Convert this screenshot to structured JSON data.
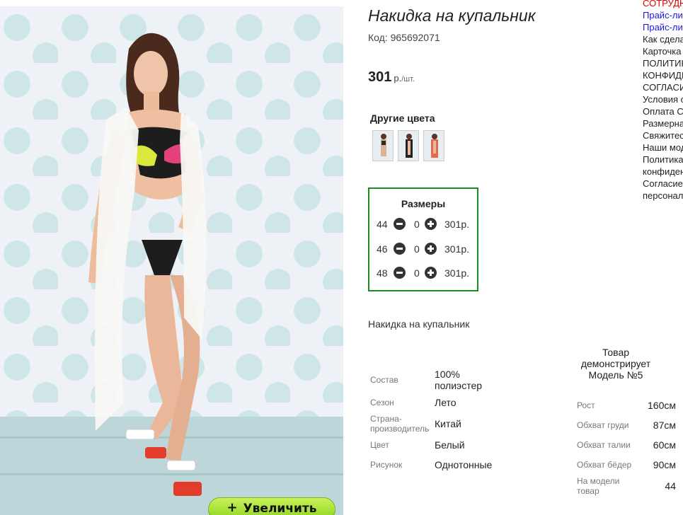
{
  "product": {
    "title": "Накидка на купальник",
    "code_label": "Код: 965692071",
    "price": "301",
    "currency": "р.",
    "unit": "/шт.",
    "zoom_label": "Увеличить",
    "zoom_icon": "+",
    "description": "Накидка на купальник"
  },
  "colors": {
    "title": "Другие цвета",
    "swatches": [
      "beige-variant",
      "black-variant",
      "coral-variant"
    ]
  },
  "sizes": {
    "title": "Размеры",
    "rows": [
      {
        "size": "44",
        "qty": "0",
        "price": "301р."
      },
      {
        "size": "46",
        "qty": "0",
        "price": "301р."
      },
      {
        "size": "48",
        "qty": "0",
        "price": "301р."
      }
    ]
  },
  "specs": [
    {
      "label": "Состав",
      "value": "100% полиэстер"
    },
    {
      "label": "Сезон",
      "value": "Лето"
    },
    {
      "label": "Страна-производитель",
      "value": "Китай"
    },
    {
      "label": "Цвет",
      "value": "Белый"
    },
    {
      "label": "Рисунок",
      "value": "Однотонные"
    }
  ],
  "model": {
    "heading": "Товар демонстрирует Модель №5",
    "rows": [
      {
        "label": "Рост",
        "value": "160см"
      },
      {
        "label": "Обхват груди",
        "value": "87см"
      },
      {
        "label": "Обхват талии",
        "value": "60см"
      },
      {
        "label": "Обхват бёдер",
        "value": "90см"
      },
      {
        "label": "На модели товар",
        "value": "44"
      }
    ]
  },
  "menu": [
    {
      "label": "СОТРУДНИЧЕСТВО",
      "color": "red"
    },
    {
      "label": "Прайс-лист",
      "color": "blue"
    },
    {
      "label": "Прайс-лист",
      "color": "blue"
    },
    {
      "label": "Как сделать заказ",
      "color": "dark"
    },
    {
      "label": "Карточка",
      "color": "dark"
    },
    {
      "label": "ПОЛИТИКА",
      "color": "dark"
    },
    {
      "label": "КОНФИДЕНЦИАЛЬНОСТИ",
      "color": "dark"
    },
    {
      "label": "СОГЛАСИЕ",
      "color": "dark"
    },
    {
      "label": "Условия оплаты",
      "color": "dark"
    },
    {
      "label": "Оплата С",
      "color": "dark"
    },
    {
      "label": "Размерная",
      "color": "dark"
    },
    {
      "label": "Свяжитесь",
      "color": "dark"
    },
    {
      "label": "Наши модели",
      "color": "dark"
    },
    {
      "label": "Политика",
      "color": "dark"
    },
    {
      "label": "конфиденциальности",
      "color": "dark"
    },
    {
      "label": "Согласие",
      "color": "dark"
    },
    {
      "label": "персональных",
      "color": "dark"
    }
  ],
  "theme": {
    "accent_green": "#1e8a1e",
    "button_green": "#a6e033",
    "menu_red": "#e00000",
    "menu_blue": "#1a1adb"
  }
}
